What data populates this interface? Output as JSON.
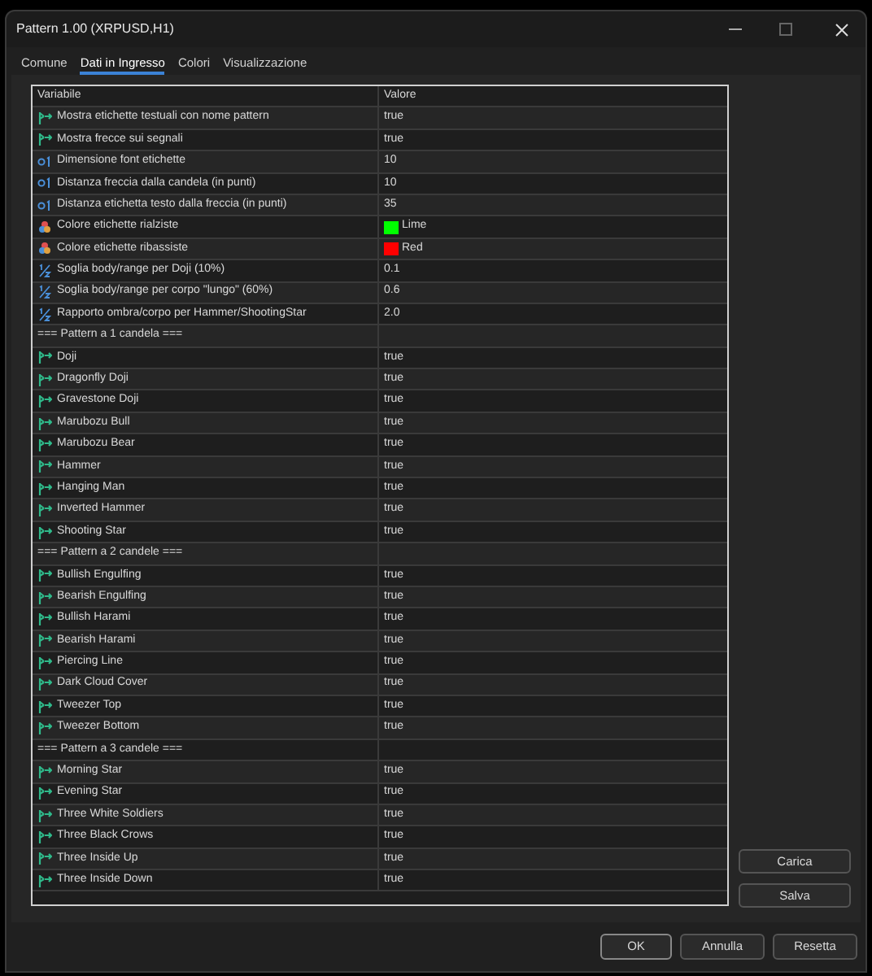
{
  "window": {
    "title": "Pattern 1.00 (XRPUSD,H1)"
  },
  "tabs": [
    {
      "label": "Comune",
      "selected": false
    },
    {
      "label": "Dati in Ingresso",
      "selected": true
    },
    {
      "label": "Colori",
      "selected": false
    },
    {
      "label": "Visualizzazione",
      "selected": false
    }
  ],
  "table": {
    "columns": [
      "Variabile",
      "Valore"
    ],
    "rows": [
      {
        "kind": "bool",
        "name": "Mostra etichette testuali con nome pattern",
        "value": "true"
      },
      {
        "kind": "bool",
        "name": "Mostra frecce sui segnali",
        "value": "true"
      },
      {
        "kind": "int",
        "name": "Dimensione font etichette",
        "value": "10"
      },
      {
        "kind": "int",
        "name": "Distanza freccia dalla candela (in punti)",
        "value": "10"
      },
      {
        "kind": "int",
        "name": "Distanza etichetta testo dalla freccia (in punti)",
        "value": "35"
      },
      {
        "kind": "color",
        "name": "Colore etichette rialziste",
        "value": "Lime",
        "color": "#00ff00"
      },
      {
        "kind": "color",
        "name": "Colore etichette ribassiste",
        "value": "Red",
        "color": "#ff0000"
      },
      {
        "kind": "double",
        "name": "Soglia body/range per Doji (10%)",
        "value": "0.1"
      },
      {
        "kind": "double",
        "name": "Soglia body/range per corpo \"lungo\" (60%)",
        "value": "0.6"
      },
      {
        "kind": "double",
        "name": "Rapporto ombra/corpo per Hammer/ShootingStar",
        "value": "2.0"
      },
      {
        "kind": "section",
        "name": "=== Pattern a 1 candela ==="
      },
      {
        "kind": "bool",
        "name": "Doji",
        "value": "true"
      },
      {
        "kind": "bool",
        "name": "Dragonfly Doji",
        "value": "true"
      },
      {
        "kind": "bool",
        "name": "Gravestone Doji",
        "value": "true"
      },
      {
        "kind": "bool",
        "name": "Marubozu Bull",
        "value": "true"
      },
      {
        "kind": "bool",
        "name": "Marubozu Bear",
        "value": "true"
      },
      {
        "kind": "bool",
        "name": "Hammer",
        "value": "true"
      },
      {
        "kind": "bool",
        "name": "Hanging Man",
        "value": "true"
      },
      {
        "kind": "bool",
        "name": "Inverted Hammer",
        "value": "true"
      },
      {
        "kind": "bool",
        "name": "Shooting Star",
        "value": "true"
      },
      {
        "kind": "section",
        "name": "=== Pattern a 2 candele ==="
      },
      {
        "kind": "bool",
        "name": "Bullish Engulfing",
        "value": "true"
      },
      {
        "kind": "bool",
        "name": "Bearish Engulfing",
        "value": "true"
      },
      {
        "kind": "bool",
        "name": "Bullish Harami",
        "value": "true"
      },
      {
        "kind": "bool",
        "name": "Bearish Harami",
        "value": "true"
      },
      {
        "kind": "bool",
        "name": "Piercing Line",
        "value": "true"
      },
      {
        "kind": "bool",
        "name": "Dark Cloud Cover",
        "value": "true"
      },
      {
        "kind": "bool",
        "name": "Tweezer Top",
        "value": "true"
      },
      {
        "kind": "bool",
        "name": "Tweezer Bottom",
        "value": "true"
      },
      {
        "kind": "section",
        "name": "=== Pattern a 3 candele ==="
      },
      {
        "kind": "bool",
        "name": "Morning Star",
        "value": "true"
      },
      {
        "kind": "bool",
        "name": "Evening Star",
        "value": "true"
      },
      {
        "kind": "bool",
        "name": "Three White Soldiers",
        "value": "true"
      },
      {
        "kind": "bool",
        "name": "Three Black Crows",
        "value": "true"
      },
      {
        "kind": "bool",
        "name": "Three Inside Up",
        "value": "true"
      },
      {
        "kind": "bool",
        "name": "Three Inside Down",
        "value": "true"
      }
    ]
  },
  "side_buttons": [
    "Carica",
    "Salva"
  ],
  "footer_buttons": [
    "OK",
    "Annulla",
    "Resetta"
  ]
}
